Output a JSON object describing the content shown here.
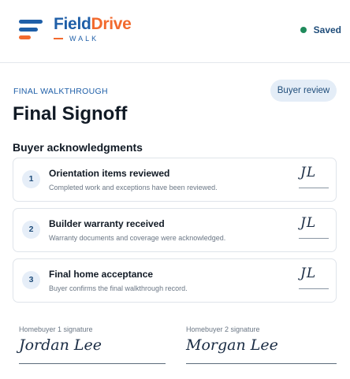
{
  "brand": {
    "name_part1": "Field",
    "name_part2": "Drive",
    "subtitle": "WALK"
  },
  "status": {
    "label": "Saved",
    "color": "#1f8a5b"
  },
  "page": {
    "eyebrow": "FINAL WALKTHROUGH",
    "title": "Final Signoff",
    "action_label": "Buyer review"
  },
  "acknowledgments": {
    "title": "Buyer acknowledgments",
    "items": [
      {
        "number": "1",
        "title": "Orientation items reviewed",
        "description": "Completed work and exceptions have been reviewed.",
        "initials": "JL"
      },
      {
        "number": "2",
        "title": "Builder warranty received",
        "description": "Warranty documents and coverage were acknowledged.",
        "initials": "JL"
      },
      {
        "number": "3",
        "title": "Final home acceptance",
        "description": "Buyer confirms the final walkthrough record.",
        "initials": "JL"
      }
    ]
  },
  "signatures": [
    {
      "label": "Homebuyer 1 signature",
      "name": "Jordan Lee"
    },
    {
      "label": "Homebuyer 2 signature",
      "name": "Morgan Lee"
    }
  ],
  "colors": {
    "brand_blue": "#1f5fa8",
    "brand_orange": "#f26a2e",
    "pill_bg": "#e4edf7"
  }
}
